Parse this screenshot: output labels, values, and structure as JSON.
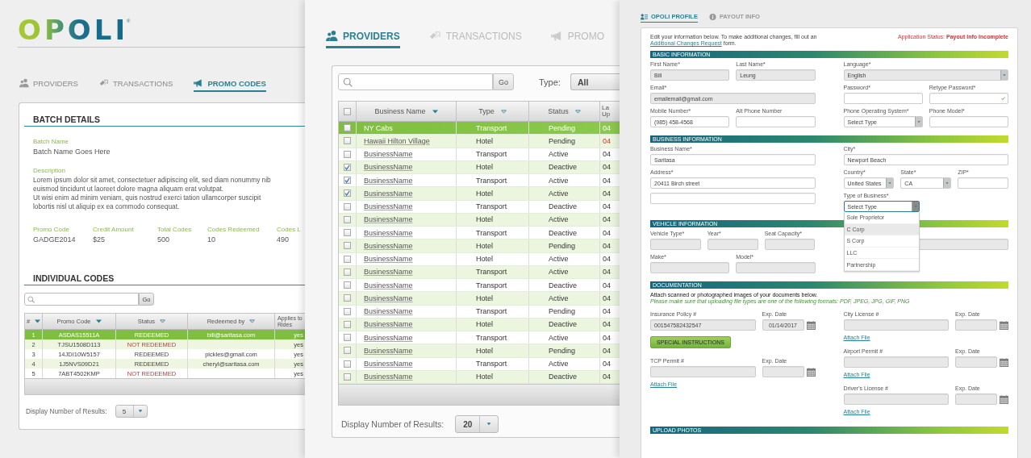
{
  "promo_panel": {
    "logo": "OPOLI",
    "logo_mark": "®",
    "tabs": [
      {
        "label": "PROVIDERS",
        "selected": false
      },
      {
        "label": "TRANSACTIONS",
        "selected": false
      },
      {
        "label": "PROMO CODES",
        "selected": true
      }
    ],
    "batch_title": "BATCH DETAILS",
    "batch_name_label": "Batch Name",
    "batch_name": "Batch Name Goes Here",
    "description_label": "Description",
    "description": "Lorem ipsum dolor sit amet, consectetuer adipiscing elit, sed diam nonummy nib\neuismod tincidunt ut laoreet dolore magna aliquam erat volutpat.\nUt wisi enim ad minim veniam, quis nostrud exerci tation ullamcorper suscipit\nlobortis nisl ut aliquip ex ea commodo consequat.",
    "stats": [
      {
        "label": "Promo Code",
        "value": "GADGE2014"
      },
      {
        "label": "Credit Amount",
        "value": "$25"
      },
      {
        "label": "Total Codes",
        "value": "500"
      },
      {
        "label": "Codes Redeemed",
        "value": "10"
      },
      {
        "label": "Codes L",
        "value": "490"
      }
    ],
    "codes_title": "INDIVIDUAL CODES",
    "go": "Go",
    "columns": [
      {
        "label": "#",
        "sort_active": true
      },
      {
        "label": "Promo Code",
        "sort_active": true
      },
      {
        "label": "Status",
        "sort_active": false
      },
      {
        "label": "Redeemed by",
        "sort_active": false
      },
      {
        "label": "Applies to Rides"
      }
    ],
    "rows": [
      {
        "number": "1",
        "code": "ASDAS15511A",
        "status": "REDEEMED",
        "redeemed": true,
        "email": "bill@saritasa.com",
        "applies": "yes",
        "selected": true
      },
      {
        "number": "2",
        "code": "TJSU1508D113",
        "status": "NOT REDEEMED",
        "redeemed": false,
        "applies": "yes",
        "selected": false
      },
      {
        "number": "3",
        "code": "14JDI10W5157",
        "status": "REDEEMED",
        "redeemed": true,
        "email": "pickles@gmail.com",
        "applies": "yes",
        "selected": false
      },
      {
        "number": "4",
        "code": "1J5NVS09D21",
        "status": "REDEEMED",
        "redeemed": true,
        "email": "cheryl@saritasa.com",
        "applies": "yes",
        "selected": false
      },
      {
        "number": "5",
        "code": "7ABT4502KMP",
        "status": "NOT REDEEMED",
        "redeemed": false,
        "applies": "yes",
        "selected": false
      }
    ],
    "results_label": "Display Number of Results:",
    "results_value": "5"
  },
  "providers_panel": {
    "tabs": [
      {
        "label": "PROVIDERS",
        "selected": true
      },
      {
        "label": "TRANSACTIONS",
        "selected": false
      },
      {
        "label": "PROMO",
        "selected": false
      }
    ],
    "go": "Go",
    "type_label": "Type:",
    "type_value": "All",
    "all_checked": false,
    "columns": [
      {
        "label": "Business Name",
        "sort_active": true
      },
      {
        "label": "Type",
        "sort_active": false
      },
      {
        "label": "Status",
        "sort_active": false
      },
      {
        "label": "La Up"
      }
    ],
    "rows": [
      {
        "name": "NY Cabs",
        "type": "Transport",
        "status": "Pending",
        "date": "04",
        "checked": false,
        "selected": true,
        "date_alert": false
      },
      {
        "name": "Hawaii Hilton Village",
        "type": "Hotel",
        "status": "Pending",
        "date": "04",
        "checked": false,
        "selected": false,
        "date_alert": true
      },
      {
        "name": "BusinessName",
        "type": "Transport",
        "status": "Active",
        "date": "04",
        "checked": false,
        "selected": false,
        "date_alert": false
      },
      {
        "name": "BusinessName",
        "type": "Hotel",
        "status": "Deactive",
        "date": "04",
        "checked": true,
        "selected": false,
        "date_alert": false
      },
      {
        "name": "BusinessName",
        "type": "Transport",
        "status": "Active",
        "date": "04",
        "checked": true,
        "selected": false,
        "date_alert": false
      },
      {
        "name": "BusinessName",
        "type": "Hotel",
        "status": "Active",
        "date": "04",
        "checked": true,
        "selected": false,
        "date_alert": false
      },
      {
        "name": "BusinessName",
        "type": "Transport",
        "status": "Deactive",
        "date": "04",
        "checked": false,
        "selected": false,
        "date_alert": false
      },
      {
        "name": "BusinessName",
        "type": "Hotel",
        "status": "Active",
        "date": "04",
        "checked": false,
        "selected": false,
        "date_alert": false
      },
      {
        "name": "BusinessName",
        "type": "Transport",
        "status": "Deactive",
        "date": "04",
        "checked": false,
        "selected": false,
        "date_alert": false
      },
      {
        "name": "BusinessName",
        "type": "Hotel",
        "status": "Pending",
        "date": "04",
        "checked": false,
        "selected": false,
        "date_alert": false
      },
      {
        "name": "BusinessName",
        "type": "Hotel",
        "status": "Active",
        "date": "04",
        "checked": false,
        "selected": false,
        "date_alert": false
      },
      {
        "name": "BusinessName",
        "type": "Transport",
        "status": "Active",
        "date": "04",
        "checked": false,
        "selected": false,
        "date_alert": false
      },
      {
        "name": "BusinessName",
        "type": "Transport",
        "status": "Deactive",
        "date": "04",
        "checked": false,
        "selected": false,
        "date_alert": false
      },
      {
        "name": "BusinessName",
        "type": "Hotel",
        "status": "Active",
        "date": "04",
        "checked": false,
        "selected": false,
        "date_alert": false
      },
      {
        "name": "BusinessName",
        "type": "Transport",
        "status": "Pending",
        "date": "04",
        "checked": false,
        "selected": false,
        "date_alert": false
      },
      {
        "name": "BusinessName",
        "type": "Hotel",
        "status": "Deactive",
        "date": "04",
        "checked": false,
        "selected": false,
        "date_alert": false
      },
      {
        "name": "BusinessName",
        "type": "Transport",
        "status": "Active",
        "date": "04",
        "checked": false,
        "selected": false,
        "date_alert": false
      },
      {
        "name": "BusinessName",
        "type": "Hotel",
        "status": "Pending",
        "date": "04",
        "checked": false,
        "selected": false,
        "date_alert": false
      },
      {
        "name": "BusinessName",
        "type": "Transport",
        "status": "Active",
        "date": "04",
        "checked": false,
        "selected": false,
        "date_alert": false
      },
      {
        "name": "BusinessName",
        "type": "Hotel",
        "status": "Deactive",
        "date": "04",
        "checked": false,
        "selected": false,
        "date_alert": false
      }
    ],
    "results_label": "Display Number of Results:",
    "results_value": "20"
  },
  "profile_panel": {
    "tabs": [
      {
        "label": "OPOLI PROFILE",
        "selected": true
      },
      {
        "label": "PAYOUT INFO",
        "selected": false
      }
    ],
    "intro": "Edit your information below. To make additional changes, fill out an",
    "intro_link": "Additional Changes Request",
    "intro_end": "form.",
    "status": "Application Status: **Payout Info Incomplete**",
    "sections": [
      {
        "title": "BASIC INFORMATION",
        "left": [
          {
            "kind": "fields",
            "fields": [
              {
                "label": "First Name*",
                "kind": "text",
                "value": "Bill",
                "disabled": true
              },
              {
                "label": "Last Name*",
                "kind": "text",
                "value": "Leung",
                "disabled": true
              }
            ]
          },
          {
            "kind": "fields",
            "fields": [
              {
                "label": "Email*",
                "kind": "text",
                "value": "emailemail@gmail.com",
                "disabled": true
              }
            ]
          },
          {
            "kind": "fields",
            "fields": [
              {
                "label": "Mobile Number*",
                "kind": "text",
                "value": "(985) 458-4568",
                "disabled": false
              },
              {
                "label": "Alt Phone Number",
                "kind": "text",
                "disabled": false
              }
            ]
          }
        ],
        "right": [
          {
            "kind": "fields",
            "fields": [
              {
                "label": "Language*",
                "kind": "select",
                "value": "English",
                "disabled": true,
                "expanded": false
              }
            ]
          },
          {
            "kind": "fields",
            "fields": [
              {
                "label": "Password*",
                "kind": "text",
                "disabled": false,
                "valid": false
              },
              {
                "label": "Retype Password*",
                "kind": "text",
                "disabled": false,
                "valid": true
              }
            ]
          },
          {
            "kind": "fields",
            "fields": [
              {
                "label": "Phone Operating System*",
                "kind": "select",
                "value": "Select Type",
                "disabled": false,
                "expanded": false
              },
              {
                "label": "Phone Model*",
                "kind": "text",
                "disabled": false
              }
            ]
          }
        ]
      },
      {
        "title": "BUSINESS INFORMATION",
        "left": [
          {
            "kind": "fields",
            "fields": [
              {
                "label": "Business Name*",
                "kind": "text",
                "value": "Saritasa",
                "disabled": false
              }
            ]
          },
          {
            "kind": "fields",
            "fields": [
              {
                "label": "Address*",
                "kind": "text",
                "value": "20411 Birch street",
                "disabled": false
              }
            ]
          },
          {
            "kind": "fields",
            "fields": [
              {
                "kind": "text",
                "disabled": false
              }
            ]
          }
        ],
        "right": [
          {
            "kind": "fields",
            "fields": [
              {
                "label": "City*",
                "kind": "text",
                "value": "Newport Beach",
                "disabled": false
              }
            ]
          },
          {
            "kind": "fields",
            "fields": [
              {
                "label": "Country*",
                "kind": "select",
                "value": "United States",
                "disabled": false,
                "expanded": false
              },
              {
                "label": "State*",
                "kind": "select",
                "value": "CA",
                "disabled": false,
                "expanded": false
              },
              {
                "label": "ZIP*",
                "kind": "text",
                "disabled": false
              }
            ]
          },
          {
            "kind": "fields",
            "fields": [
              {
                "label": "Type of Business*",
                "kind": "select",
                "value": "Select Type",
                "disabled": false,
                "expanded": true,
                "options": [
                  {
                    "label": "Sole Proprietor",
                    "selected": false
                  },
                  {
                    "label": "C Corp",
                    "selected": true
                  },
                  {
                    "label": "S Corp",
                    "selected": false
                  },
                  {
                    "label": "LLC",
                    "selected": false
                  },
                  {
                    "label": "Partnership",
                    "selected": false
                  }
                ]
              }
            ]
          }
        ]
      },
      {
        "title": "VEHICLE INFORMATION",
        "left": [
          {
            "kind": "fields",
            "fields": [
              {
                "label": "Vehicle Type*",
                "kind": "text",
                "disabled": true
              },
              {
                "label": "Year*",
                "kind": "text",
                "disabled": true
              },
              {
                "label": "Seat Capacity*",
                "kind": "text",
                "disabled": true
              }
            ]
          },
          {
            "kind": "fields",
            "fields": [
              {
                "label": "Make*",
                "kind": "text",
                "disabled": true
              },
              {
                "label": "Model*",
                "kind": "text",
                "disabled": true
              }
            ]
          }
        ],
        "right": [
          {
            "kind": "fields",
            "fields": [
              {
                "kind": "text",
                "disabled": true
              }
            ]
          }
        ]
      },
      {
        "title": "DOCUMENTATION",
        "notes": [
          {
            "kind": "plain",
            "text": "Attach scanned or photographed images of your documents below."
          },
          {
            "kind": "hint",
            "text": "Please make sure that uploading file types are one of the following formats: PDF, JPEG, JPG, GIF, PNG"
          }
        ],
        "left": [
          {
            "kind": "fields",
            "fields": [
              {
                "label": "Insurance Policy #",
                "kind": "text",
                "value": "001547582432547",
                "disabled": true
              },
              {
                "label": "Exp. Date",
                "kind": "date",
                "value": "01/14/2017",
                "disabled": true
              }
            ]
          },
          {
            "kind": "button",
            "label": "SPECIAL INSTRUCTIONS"
          },
          {
            "kind": "fields",
            "fields": [
              {
                "label": "TCP Permit #",
                "kind": "text",
                "disabled": true
              },
              {
                "label": "Exp. Date",
                "kind": "date",
                "disabled": true
              }
            ]
          },
          {
            "kind": "link",
            "label": "Attach File"
          }
        ],
        "right": [
          {
            "kind": "fields",
            "fields": [
              {
                "label": "City License #",
                "kind": "text",
                "disabled": true
              },
              {
                "label": "Exp. Date",
                "kind": "date",
                "disabled": true
              }
            ]
          },
          {
            "kind": "link",
            "label": "Attach File"
          },
          {
            "kind": "fields",
            "fields": [
              {
                "label": "Airport Permit #",
                "kind": "text",
                "disabled": true
              },
              {
                "label": "Exp. Date",
                "kind": "date",
                "disabled": true
              }
            ]
          },
          {
            "kind": "link",
            "label": "Attach File"
          },
          {
            "kind": "fields",
            "fields": [
              {
                "label": "Driver's License #",
                "kind": "text",
                "disabled": true
              },
              {
                "label": "Exp. Date",
                "kind": "date",
                "disabled": true
              }
            ]
          },
          {
            "kind": "link",
            "label": "Attach File"
          }
        ]
      },
      {
        "title": "UPLOAD PHOTOS"
      }
    ]
  }
}
